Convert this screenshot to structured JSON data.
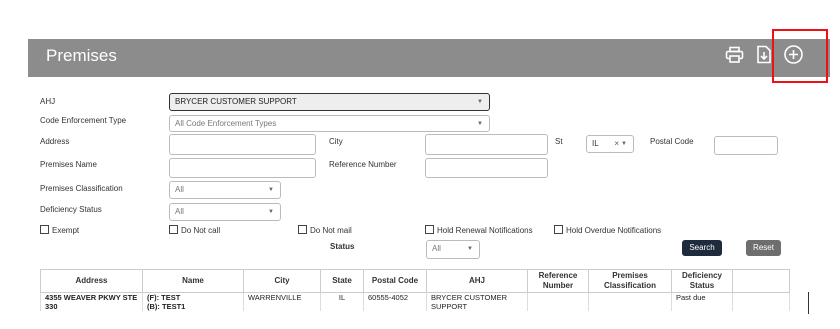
{
  "header": {
    "title": "Premises",
    "print_icon": "print-icon",
    "export_icon": "export-icon",
    "add_icon": "add-circle-icon"
  },
  "filters": {
    "ahj_label": "AHJ",
    "ahj_value": "BRYCER CUSTOMER SUPPORT",
    "code_type_label": "Code Enforcement Type",
    "code_type_value": "All Code Enforcement Types",
    "address_label": "Address",
    "city_label": "City",
    "st_label": "St",
    "st_value": "IL",
    "postal_label": "Postal Code",
    "premises_name_label": "Premises Name",
    "reference_label": "Reference Number",
    "classification_label": "Premises Classification",
    "classification_value": "All",
    "deficiency_label": "Deficiency Status",
    "deficiency_value": "All",
    "exempt_label": "Exempt",
    "do_not_call_label": "Do Not call",
    "do_not_mail_label": "Do Not mail",
    "hold_renewal_label": "Hold Renewal Notifications",
    "hold_overdue_label": "Hold Overdue Notifications",
    "status_label": "Status",
    "status_value": "All",
    "search_label": "Search",
    "reset_label": "Reset"
  },
  "table": {
    "headers": [
      "Address",
      "Name",
      "City",
      "State",
      "Postal Code",
      "AHJ",
      "Reference Number",
      "Premises Classification",
      "Deficiency Status"
    ],
    "rows": [
      {
        "address": "4355 WEAVER PKWY STE 330",
        "name_f": "(F): TEST",
        "name_b": "(B): TEST1",
        "city": "WARRENVILLE",
        "state": "IL",
        "postal": "60555-4052",
        "ahj": "BRYCER CUSTOMER SUPPORT",
        "reference": "",
        "classification": "",
        "deficiency": "Past due"
      }
    ]
  },
  "colors": {
    "header_bg": "#8c8c8c",
    "search_bg": "#1f2a3c",
    "reset_bg": "#6e6e6e",
    "highlight": "#e11111"
  }
}
